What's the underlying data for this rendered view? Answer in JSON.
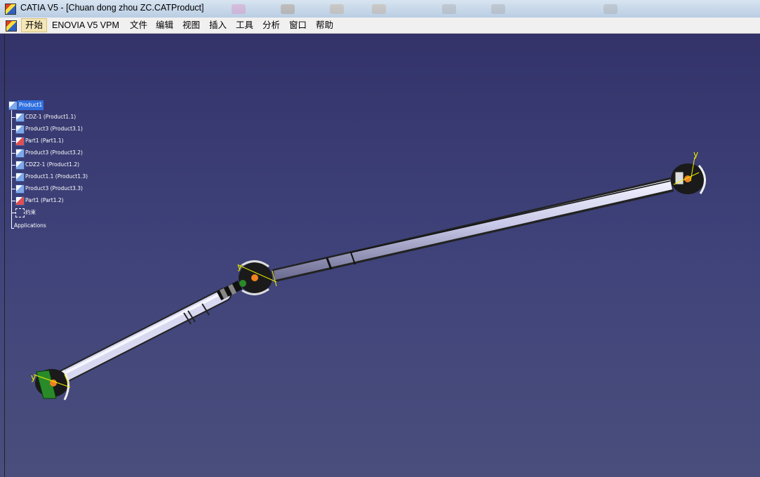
{
  "window": {
    "title": "CATIA V5 - [Chuan dong zhou ZC.CATProduct]",
    "app_icon": "catia-logo-icon"
  },
  "menubar": {
    "items": [
      {
        "label": "开始",
        "active": true
      },
      {
        "label": "ENOVIA V5 VPM"
      },
      {
        "label": "文件"
      },
      {
        "label": "编辑"
      },
      {
        "label": "视图"
      },
      {
        "label": "插入"
      },
      {
        "label": "工具"
      },
      {
        "label": "分析"
      },
      {
        "label": "窗口"
      },
      {
        "label": "帮助"
      }
    ]
  },
  "tree": {
    "root": {
      "label": "Product1",
      "icon": "product-icon",
      "selected": true
    },
    "children": [
      {
        "label": "CDZ-1 (Product1.1)",
        "icon": "product-icon"
      },
      {
        "label": "Product3 (Product3.1)",
        "icon": "product-icon"
      },
      {
        "label": "Part1 (Part1.1)",
        "icon": "part-icon"
      },
      {
        "label": "Product3 (Product3.2)",
        "icon": "product-icon"
      },
      {
        "label": "CDZ2-1 (Product1.2)",
        "icon": "product-icon"
      },
      {
        "label": "Product1.1 (Product1.3)",
        "icon": "product-icon"
      },
      {
        "label": "Product3 (Product3.3)",
        "icon": "product-icon"
      },
      {
        "label": "Part1 (Part1.2)",
        "icon": "part-icon"
      },
      {
        "label": "约束",
        "icon": "constraint-icon"
      }
    ],
    "applications": "Applications"
  },
  "colors": {
    "viewport_top": "#33336a",
    "viewport_bottom": "#4a4e7c",
    "shaft": "#c8c8e8",
    "joint_green": "#2a8a2a",
    "axis_yellow": "#f0f000",
    "joint_orange": "#f08020",
    "selection_blue": "#3070e0"
  },
  "axis_labels": {
    "y": "y"
  }
}
